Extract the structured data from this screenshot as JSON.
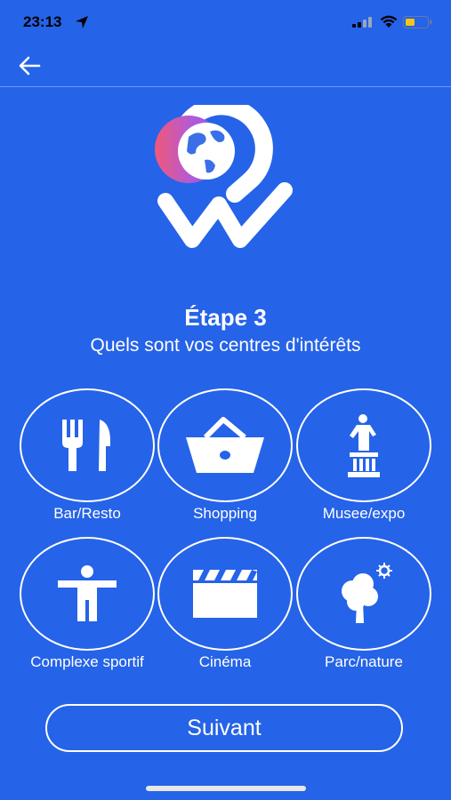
{
  "status_bar": {
    "time": "23:13"
  },
  "step": {
    "title": "Étape 3",
    "subtitle": "Quels sont vos centres d'intérêts"
  },
  "interests": [
    {
      "label": "Bar/Resto",
      "icon": "fork-knife-icon"
    },
    {
      "label": "Shopping",
      "icon": "basket-icon"
    },
    {
      "label": "Musee/expo",
      "icon": "statue-icon"
    },
    {
      "label": "Complexe sportif",
      "icon": "person-icon"
    },
    {
      "label": "Cinéma",
      "icon": "clapperboard-icon"
    },
    {
      "label": "Parc/nature",
      "icon": "tree-icon"
    }
  ],
  "next_button": {
    "label": "Suivant"
  },
  "colors": {
    "background": "#2563e8",
    "foreground": "#ffffff",
    "logo_accent_pink": "#f0587a",
    "logo_accent_purple": "#8a5cf0"
  }
}
